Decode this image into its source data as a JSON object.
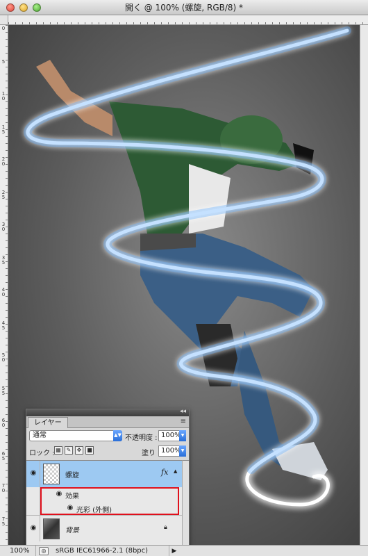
{
  "window": {
    "title": "開く @ 100% (螺旋, RGB/8) *"
  },
  "rulers": {
    "left_labels": [
      "0",
      "5",
      "1 0",
      "1 5",
      "2 0",
      "2 5",
      "3 0",
      "3 5",
      "4 0",
      "4 5",
      "5 0",
      "5 5",
      "6 0",
      "6 5",
      "7 0",
      "7 5"
    ]
  },
  "status_bar": {
    "zoom": "100%",
    "profile": "sRGB IEC61966-2.1 (8bpc)"
  },
  "layers_panel": {
    "tab_label": "レイヤー",
    "blend_mode": "通常",
    "opacity_label": "不透明度 :",
    "opacity_value": "100%",
    "lock_label": "ロック :",
    "fill_label": "塗り :",
    "fill_value": "100%",
    "layers": [
      {
        "name": "螺旋",
        "fx": "fx",
        "selected": true
      },
      {
        "name": "効果"
      },
      {
        "name": "光彩 (外側)"
      },
      {
        "name": "背景"
      }
    ]
  },
  "colors": {
    "selection": "#9dc9f2",
    "highlight_box": "#e0101c",
    "glow": "#5aa8ff"
  }
}
